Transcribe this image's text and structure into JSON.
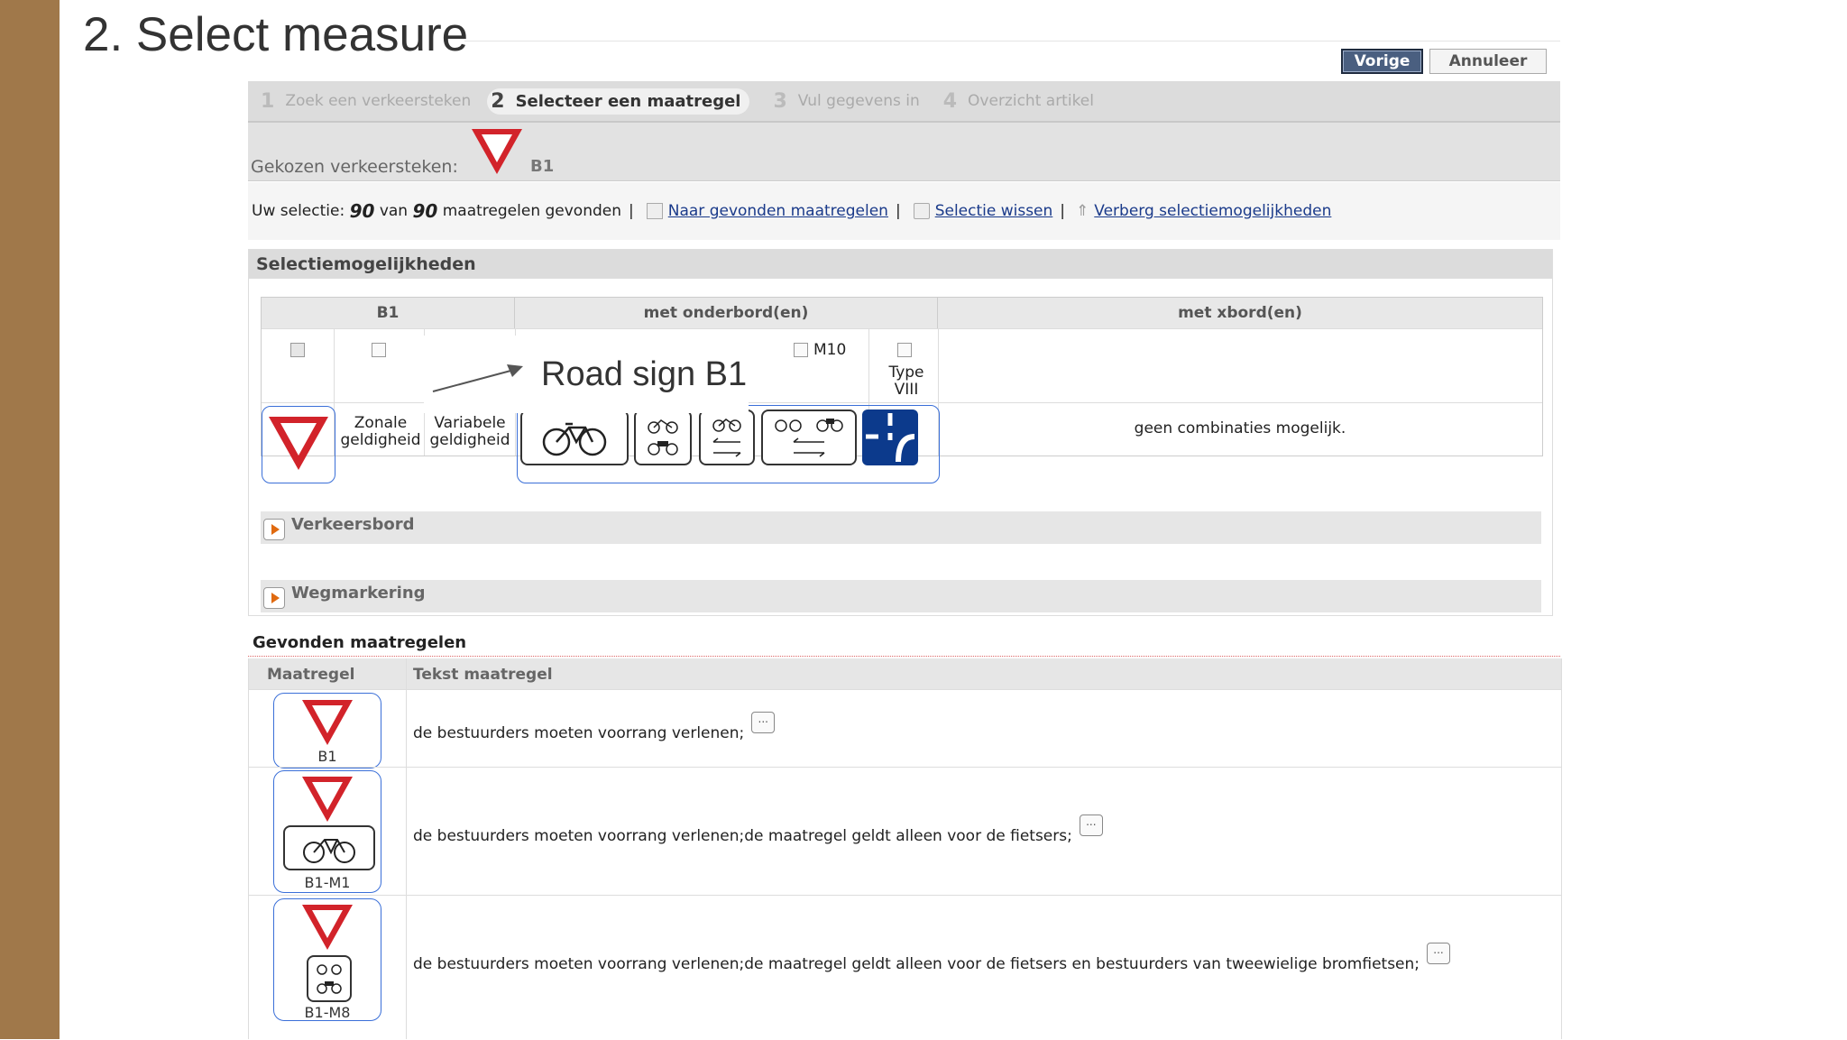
{
  "slide": {
    "title": "2. Select measure"
  },
  "header_buttons": {
    "previous": "Vorige",
    "cancel": "Annuleer"
  },
  "steps": [
    {
      "num": "1",
      "label": "Zoek een verkeersteken",
      "active": false
    },
    {
      "num": "2",
      "label": "Selecteer een maatregel",
      "active": true
    },
    {
      "num": "3",
      "label": "Vul gegevens in",
      "active": false
    },
    {
      "num": "4",
      "label": "Overzicht artikel",
      "active": false
    }
  ],
  "chosen": {
    "label": "Gekozen verkeersteken:",
    "code": "B1"
  },
  "selection_bar": {
    "prefix": "Uw selectie:",
    "count": "90",
    "of": "van",
    "total": "90",
    "suffix": "maatregelen gevonden",
    "link_found": "Naar gevonden maatregelen",
    "link_clear": "Selectie wissen",
    "link_hide": "Verberg selectiemogelijkheden"
  },
  "options": {
    "title": "Selectiemogelijkheden",
    "col_b1": "B1",
    "col_onderbord": "met onderbord(en)",
    "col_xbord": "met xbord(en)",
    "m10_label": "M10",
    "type_viii_label": "Type VIII",
    "zonale": "Zonale geldigheid",
    "variabele": "Variabele geldigheid",
    "no_combinations": "geen combinaties mogelijk.",
    "annotation": "Road sign B1"
  },
  "accordions": [
    {
      "label": "Verkeersbord"
    },
    {
      "label": "Wegmarkering"
    }
  ],
  "found": {
    "title": "Gevonden maatregelen",
    "col_measure": "Maatregel",
    "col_text": "Tekst maatregel",
    "rows": [
      {
        "code": "B1",
        "text": "de bestuurders moeten voorrang verlenen;",
        "more": "..."
      },
      {
        "code": "B1-M1",
        "text": "de bestuurders moeten voorrang verlenen;de maatregel geldt alleen voor de fietsers;",
        "more": "..."
      },
      {
        "code": "B1-M8",
        "text": "de bestuurders moeten voorrang verlenen;de maatregel geldt alleen voor de fietsers en bestuurders van tweewielige bromfietsen;",
        "more": "..."
      }
    ]
  },
  "colors": {
    "accent_blue": "#3a6fd8",
    "sign_red": "#d2232a",
    "slide_bar": "#a0784a",
    "sign_navy": "#0c3a8c"
  }
}
